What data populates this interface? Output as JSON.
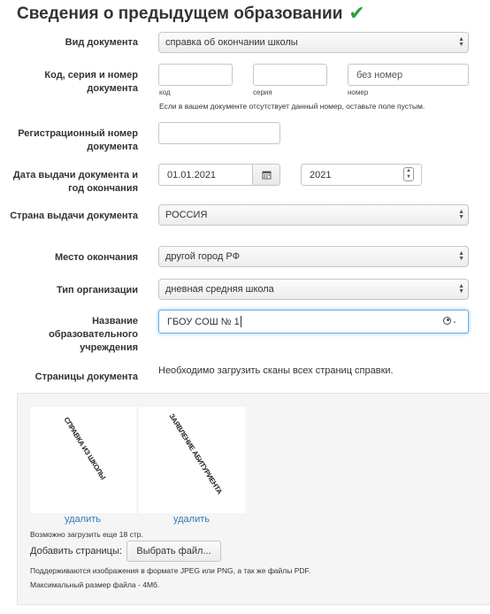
{
  "title": "Сведения о предыдущем образовании",
  "title_icon": "checkmark-icon",
  "fields": {
    "doc_type": {
      "label": "Вид документа",
      "value": "справка об окончании школы"
    },
    "doc_code": {
      "label": "Код, серия и номер документа",
      "code_sub": "код",
      "series_sub": "серия",
      "number_sub": "номер",
      "code_value": "",
      "series_value": "",
      "number_value": "без номер",
      "hint": "Если в вашем документе отсутствует данный номер, оставьте поле пустым."
    },
    "reg_number": {
      "label": "Регистрационный номер документа",
      "value": ""
    },
    "issue_date": {
      "label": "Дата выдачи документа и год окончания",
      "date_value": "01.01.2021",
      "year_value": "2021"
    },
    "country": {
      "label": "Страна выдачи документа",
      "value": "РОССИЯ"
    },
    "place": {
      "label": "Место окончания",
      "value": "другой город РФ"
    },
    "org_type": {
      "label": "Тип организации",
      "value": "дневная средняя школа"
    },
    "institution": {
      "label": "Название образовательного учреждения",
      "value": "ГБОУ СОШ № 1"
    },
    "pages": {
      "label": "Страницы документа",
      "note": "Необходимо загрузить сканы всех страниц справки."
    }
  },
  "upload": {
    "thumbs": [
      {
        "caption": "СПРАВКА ИЗ ШКОЛЫ",
        "delete_label": "удалить"
      },
      {
        "caption": "ЗАЯВЛЕНИЕ АБИТУРИЕНТА",
        "delete_label": "удалить"
      }
    ],
    "remaining": "Возможно загрузить еще 18 стр.",
    "add_pages_label": "Добавить страницы:",
    "choose_file_label": "Выбрать файл...",
    "formats_note": "Поддерживаются изображения в формате JPEG или PNG, а так же файлы PDF.",
    "max_size_note": "Максимальный размер файла - 4Мб."
  },
  "colors": {
    "accent_link": "#337ab7",
    "check_green": "#2e9f3e",
    "focus_blue": "#66afe9"
  }
}
